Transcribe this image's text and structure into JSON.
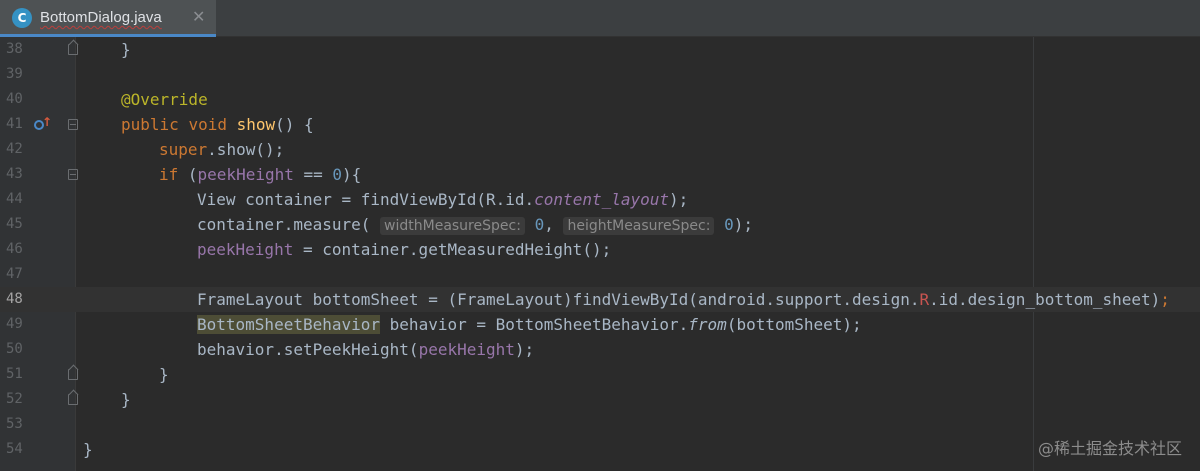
{
  "tab": {
    "icon_letter": "C",
    "filename": "BottomDialog.java",
    "close": "✕"
  },
  "lines": [
    {
      "n": "38"
    },
    {
      "n": "39"
    },
    {
      "n": "40"
    },
    {
      "n": "41"
    },
    {
      "n": "42"
    },
    {
      "n": "43"
    },
    {
      "n": "44"
    },
    {
      "n": "45"
    },
    {
      "n": "46"
    },
    {
      "n": "47"
    },
    {
      "n": "48"
    },
    {
      "n": "49"
    },
    {
      "n": "50"
    },
    {
      "n": "51"
    },
    {
      "n": "52"
    },
    {
      "n": "53"
    },
    {
      "n": "54"
    }
  ],
  "code": {
    "l38": "}",
    "l40_ann": "@Override",
    "l41_public": "public",
    "l41_void": "void",
    "l41_show": "show",
    "l41_rest": "() {",
    "l42_super": "super",
    "l42_rest": ".show();",
    "l43_if": "if",
    "l43_open": " (",
    "l43_field": "peekHeight",
    "l43_eq": " == ",
    "l43_zero": "0",
    "l43_close": "){",
    "l44_pre": "View container = findViewById(R.id.",
    "l44_field": "content_layout",
    "l44_post": ");",
    "l45_pre": "container.measure(",
    "l45_hint1": "widthMeasureSpec:",
    "l45_zero1": "0",
    "l45_comma": ",",
    "l45_hint2": "heightMeasureSpec:",
    "l45_zero2": "0",
    "l45_post": ");",
    "l46_field": "peekHeight",
    "l46_post": " = container.getMeasuredHeight();",
    "l48_pre": "FrameLayout bottomSheet = (FrameLayout)findViewById(android.support.design.",
    "l48_r": "R",
    "l48_post": ".id.design_bottom_sheet)",
    "l48_semi": ";",
    "l49_cls": "BottomSheetBehavior",
    "l49_mid": " behavior = BottomSheetBehavior.",
    "l49_from": "from",
    "l49_post": "(bottomSheet);",
    "l50_pre": "behavior.setPeekHeight(",
    "l50_field": "peekHeight",
    "l50_post": ");",
    "l51": "}",
    "l52": "}",
    "l54": "}"
  },
  "watermark": "@稀土掘金技术社区",
  "colors": {
    "keyword": "#cc7832",
    "annotation": "#bbb529",
    "method": "#ffc66d",
    "field": "#9876aa",
    "number": "#6897bb",
    "text": "#a9b7c6"
  }
}
